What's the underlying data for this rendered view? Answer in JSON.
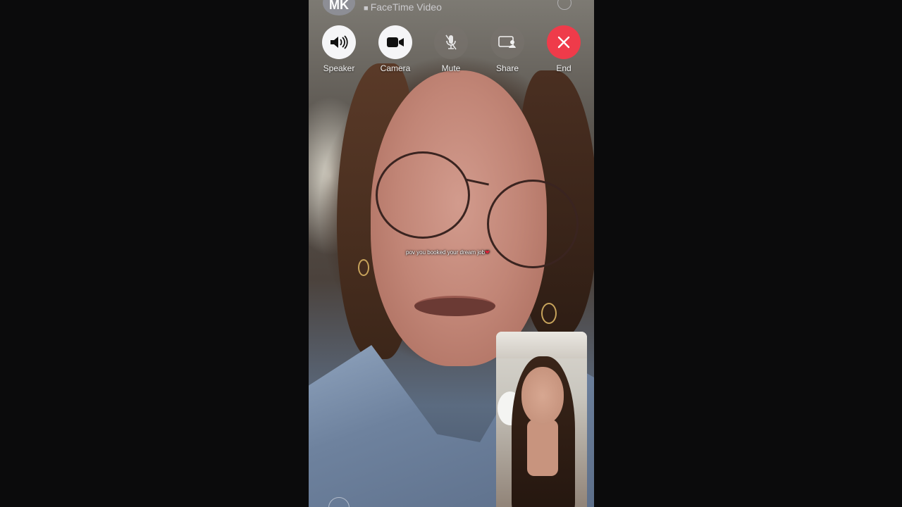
{
  "window": {
    "app": "FaceTime"
  },
  "header": {
    "avatar_initials": "MK",
    "call_type": "FaceTime Video"
  },
  "controls": [
    {
      "label": "Speaker",
      "icon": "speaker-icon",
      "style": "white"
    },
    {
      "label": "Camera",
      "icon": "video-camera-icon",
      "style": "white"
    },
    {
      "label": "Mute",
      "icon": "microphone-icon",
      "style": "grey"
    },
    {
      "label": "Share",
      "icon": "share-screen-icon",
      "style": "grey"
    },
    {
      "label": "End",
      "icon": "close-icon",
      "style": "red"
    }
  ],
  "overlay": {
    "caption": "pov you booked your dream job"
  },
  "colors": {
    "end_red": "#ef3b4a",
    "button_white": "#f5f5f7",
    "background": "#0b0b0c"
  }
}
